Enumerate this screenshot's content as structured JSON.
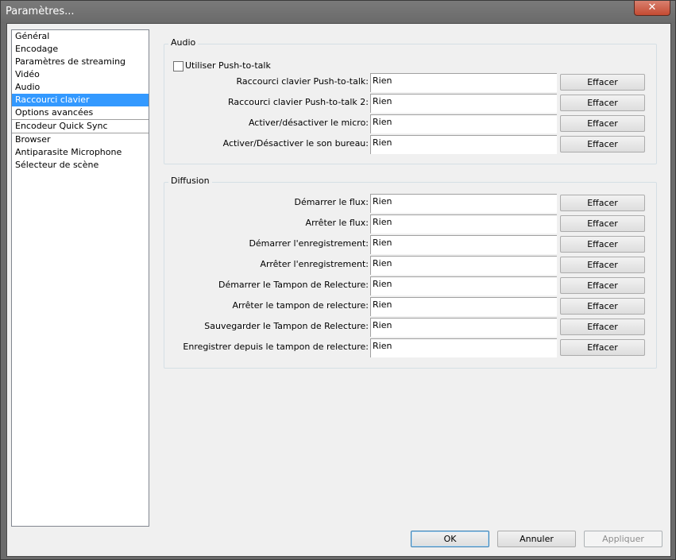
{
  "window": {
    "title": "Paramètres...",
    "close_glyph": "✕"
  },
  "sidebar": {
    "items": [
      {
        "label": "Général"
      },
      {
        "label": "Encodage"
      },
      {
        "label": "Paramètres de streaming"
      },
      {
        "label": "Vidéo"
      },
      {
        "label": "Audio"
      },
      {
        "label": "Raccourci clavier",
        "selected": true
      },
      {
        "label": "Options avancées"
      },
      {
        "label": "Encodeur Quick Sync"
      },
      {
        "label": "Browser"
      },
      {
        "label": "Antiparasite Microphone"
      },
      {
        "label": "Sélecteur de scène"
      }
    ]
  },
  "audio": {
    "title": "Audio",
    "push_to_talk_label": "Utiliser Push-to-talk",
    "rows": [
      {
        "label": "Raccourci clavier Push-to-talk:",
        "value": "Rien",
        "button": "Effacer"
      },
      {
        "label": "Raccourci clavier Push-to-talk 2:",
        "value": "Rien",
        "button": "Effacer"
      },
      {
        "label": "Activer/désactiver le micro:",
        "value": "Rien",
        "button": "Effacer"
      },
      {
        "label": "Activer/Désactiver le son bureau:",
        "value": "Rien",
        "button": "Effacer"
      }
    ]
  },
  "diffusion": {
    "title": "Diffusion",
    "rows": [
      {
        "label": "Démarrer le flux:",
        "value": "Rien",
        "button": "Effacer"
      },
      {
        "label": "Arrêter le flux:",
        "value": "Rien",
        "button": "Effacer"
      },
      {
        "label": "Démarrer l'enregistrement:",
        "value": "Rien",
        "button": "Effacer"
      },
      {
        "label": "Arrêter l'enregistrement:",
        "value": "Rien",
        "button": "Effacer"
      },
      {
        "label": "Démarrer le Tampon de Relecture:",
        "value": "Rien",
        "button": "Effacer"
      },
      {
        "label": "Arrêter le tampon de relecture:",
        "value": "Rien",
        "button": "Effacer"
      },
      {
        "label": "Sauvegarder le Tampon de Relecture:",
        "value": "Rien",
        "button": "Effacer"
      },
      {
        "label": "Enregistrer depuis le tampon de relecture:",
        "value": "Rien",
        "button": "Effacer"
      }
    ]
  },
  "footer": {
    "ok": "OK",
    "cancel": "Annuler",
    "apply": "Appliquer"
  }
}
